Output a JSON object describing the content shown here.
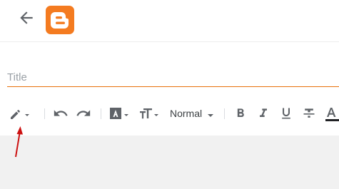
{
  "header": {
    "back_icon": "arrow-left-icon",
    "logo_icon": "blogger-logo-icon",
    "logo_color": "#f47b20"
  },
  "editor": {
    "title_placeholder": "Title",
    "title_value": "",
    "underline_color": "#e8710a"
  },
  "toolbar": {
    "mode_icon": "pencil-icon",
    "undo_icon": "undo-icon",
    "redo_icon": "redo-icon",
    "font_icon": "font-icon",
    "text_size_icon": "text-size-icon",
    "paragraph_style": "Normal",
    "bold_icon": "bold-icon",
    "italic_icon": "italic-icon",
    "underline_icon": "underline-icon",
    "strikethrough_icon": "strikethrough-icon",
    "text_color_icon": "text-color-icon"
  },
  "annotation": {
    "arrow_color": "#cc1111"
  }
}
